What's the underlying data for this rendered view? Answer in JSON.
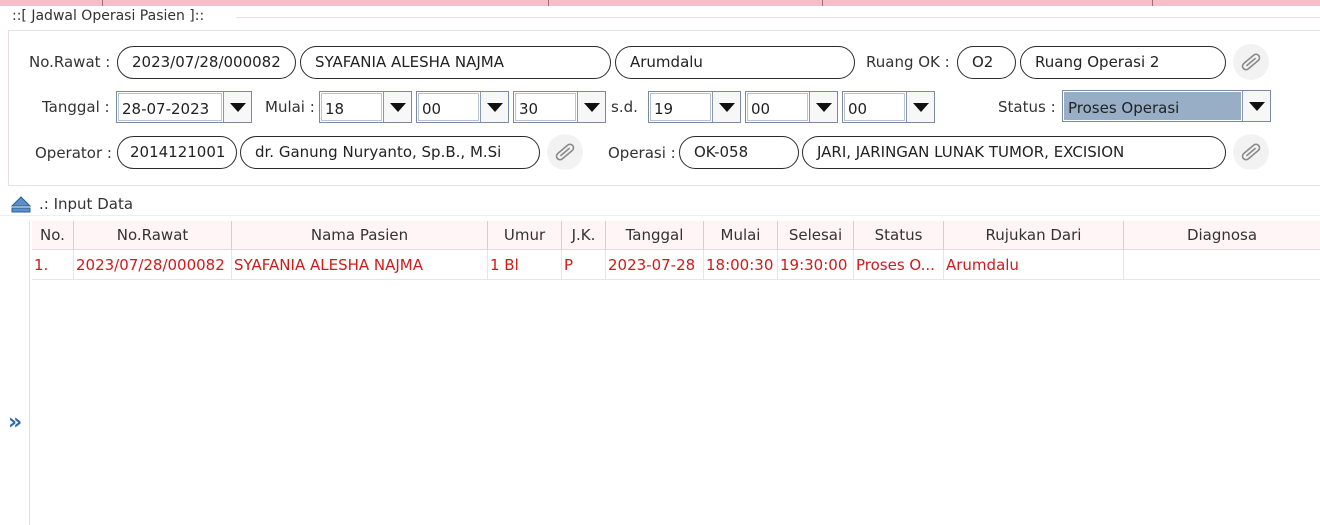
{
  "panel_title": "::[ Jadwal Operasi Pasien ]::",
  "form": {
    "no_rawat_label": "No.Rawat :",
    "no_rawat": "2023/07/28/000082",
    "nama_pasien": "SYAFANIA ALESHA NAJMA",
    "asal": "Arumdalu",
    "ruang_ok_label": "Ruang OK :",
    "ruang_kode": "O2",
    "ruang_nama": "Ruang Operasi 2",
    "tanggal_label": "Tanggal :",
    "tanggal": "28-07-2023",
    "mulai_label": "Mulai :",
    "mulai_jam": "18",
    "mulai_menit": "00",
    "mulai_detik": "30",
    "sd_label": "s.d.",
    "selesai_jam": "19",
    "selesai_menit": "00",
    "selesai_detik": "00",
    "status_label": "Status :",
    "status": "Proses Operasi",
    "operator_label": "Operator :",
    "operator_kode": "2014121001",
    "operator_nama": "dr. Ganung Nuryanto, Sp.B., M.Si",
    "operasi_label": "Operasi :",
    "operasi_kode": "OK-058",
    "operasi_nama": "JARI, JARINGAN LUNAK TUMOR, EXCISION"
  },
  "section_label": ".: Input Data",
  "table": {
    "columns": [
      "No.",
      "No.Rawat",
      "Nama Pasien",
      "Umur",
      "J.K.",
      "Tanggal",
      "Mulai",
      "Selesai",
      "Status",
      "Rujukan Dari",
      "Diagnosa"
    ],
    "rows": [
      [
        "1.",
        "2023/07/28/000082",
        "SYAFANIA ALESHA NAJMA",
        "1 Bl",
        "P",
        "2023-07-28",
        "18:00:30",
        "19:30:00",
        "Proses O...",
        "Arumdalu",
        ""
      ]
    ]
  },
  "icons": {
    "clip": "paperclip-icon",
    "collapse": "collapse-up-icon",
    "expand": "double-chevron-right-icon"
  },
  "colors": {
    "row_text": "#d11a1a",
    "header_bg": "#fff4f6",
    "status_selected_bg": "#98aec7",
    "topbar": "#f3bfc8"
  }
}
